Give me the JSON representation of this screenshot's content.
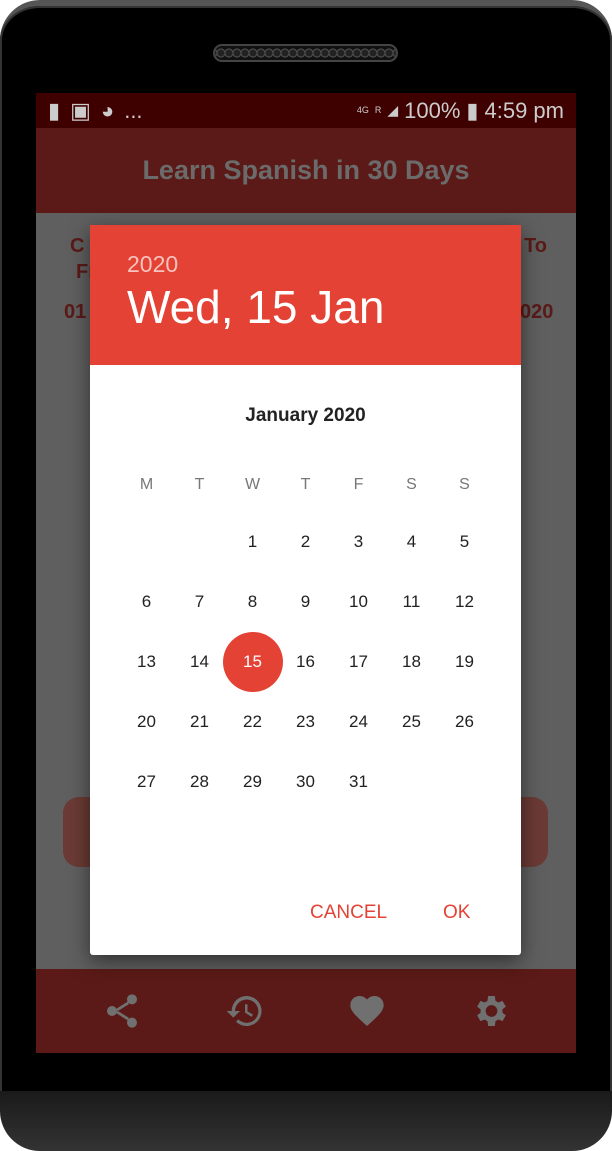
{
  "status": {
    "notification_icons": [
      "message-icon",
      "flipboard-icon",
      "trending-icon"
    ],
    "more": "...",
    "network": "4G",
    "roaming": "R",
    "battery": "100%",
    "time": "4:59 pm"
  },
  "app": {
    "title": "Learn Spanish in 30 Days"
  },
  "background_fragments": {
    "left_top": "C",
    "left_from": "Fr",
    "left_date": "01",
    "right_to": "To",
    "right_date": "020"
  },
  "dialog": {
    "year": "2020",
    "selected_date": "Wed, 15 Jan",
    "month_label": "January 2020",
    "weekdays": [
      "M",
      "T",
      "W",
      "T",
      "F",
      "S",
      "S"
    ],
    "weeks": [
      [
        "",
        "",
        "1",
        "2",
        "3",
        "4",
        "5"
      ],
      [
        "6",
        "7",
        "8",
        "9",
        "10",
        "11",
        "12"
      ],
      [
        "13",
        "14",
        "15",
        "16",
        "17",
        "18",
        "19"
      ],
      [
        "20",
        "21",
        "22",
        "23",
        "24",
        "25",
        "26"
      ],
      [
        "27",
        "28",
        "29",
        "30",
        "31",
        "",
        ""
      ]
    ],
    "selected_day": "15",
    "cancel_label": "CANCEL",
    "ok_label": "OK",
    "accent_color": "#e34234"
  },
  "bottom_nav": [
    "share-icon",
    "history-icon",
    "favorite-icon",
    "settings-icon"
  ]
}
